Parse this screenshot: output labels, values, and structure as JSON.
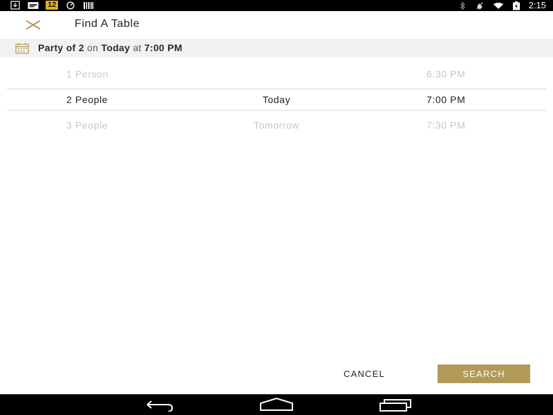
{
  "status_bar": {
    "notif_badge": "12",
    "time": "2:15"
  },
  "header": {
    "title": "Find A Table"
  },
  "summary": {
    "prefix": "Party of 2",
    "on_word": "on",
    "day": "Today",
    "at_word": "at",
    "time": "7:00 PM"
  },
  "picker": {
    "rows": [
      {
        "people": "1 Person",
        "day": "",
        "time": "6:30 PM",
        "state": "faded"
      },
      {
        "people": "2 People",
        "day": "Today",
        "time": "7:00 PM",
        "state": "selected"
      },
      {
        "people": "3 People",
        "day": "Tomorrow",
        "time": "7:30 PM",
        "state": "faded"
      }
    ]
  },
  "actions": {
    "cancel_label": "CANCEL",
    "search_label": "SEARCH"
  },
  "colors": {
    "accent": "#b19a59",
    "selected_text": "#222222",
    "faded_text": "#c6c6c6",
    "summary_bg": "#f2f2f2"
  },
  "icons": {
    "close": "close-icon",
    "calendar": "calendar-icon",
    "nav_back": "back-icon",
    "nav_home": "home-icon",
    "nav_recents": "recents-icon"
  }
}
